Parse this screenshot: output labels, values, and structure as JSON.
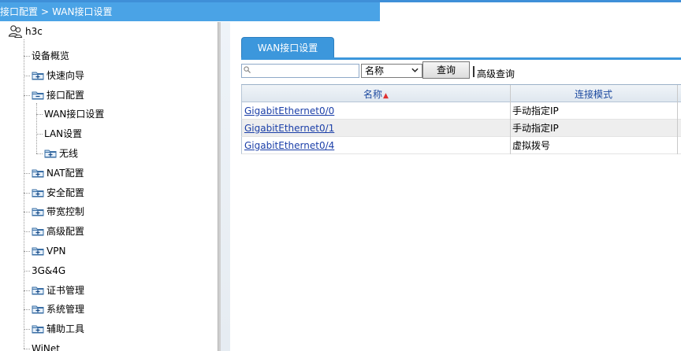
{
  "breadcrumb": {
    "section": "接口配置",
    "separator": ">",
    "page": "WAN接口设置"
  },
  "tree": {
    "root": "h3c",
    "items": [
      {
        "label": "设备概览",
        "folder": false
      },
      {
        "label": "快速向导",
        "folder": true
      },
      {
        "label": "接口配置",
        "folder": true,
        "expanded": true
      },
      {
        "label": "WAN接口设置",
        "folder": false,
        "child": true
      },
      {
        "label": "LAN设置",
        "folder": false,
        "child": true
      },
      {
        "label": "无线",
        "folder": true,
        "child": true
      },
      {
        "label": "NAT配置",
        "folder": true
      },
      {
        "label": "安全配置",
        "folder": true
      },
      {
        "label": "带宽控制",
        "folder": true
      },
      {
        "label": "高级配置",
        "folder": true
      },
      {
        "label": "VPN",
        "folder": true
      },
      {
        "label": "3G&4G",
        "folder": false
      },
      {
        "label": "证书管理",
        "folder": true
      },
      {
        "label": "系统管理",
        "folder": true
      },
      {
        "label": "辅助工具",
        "folder": true
      },
      {
        "label": "WiNet",
        "folder": false
      }
    ]
  },
  "main": {
    "tab_label": "WAN接口设置",
    "search": {
      "value": "",
      "placeholder": ""
    },
    "filter_select": {
      "value": "名称"
    },
    "query_button": "查询",
    "advanced_query": "高级查询",
    "table": {
      "columns": [
        "名称",
        "连接模式"
      ],
      "sort_indicator": "▲",
      "rows": [
        {
          "name": "GigabitEthernet0/0",
          "mode": "手动指定IP"
        },
        {
          "name": "GigabitEthernet0/1",
          "mode": "手动指定IP"
        },
        {
          "name": "GigabitEthernet0/4",
          "mode": "虚拟拨号"
        }
      ]
    }
  },
  "colors": {
    "accent": "#3c97dc",
    "link": "#1b3fa8",
    "header_text": "#1d4aa0"
  }
}
